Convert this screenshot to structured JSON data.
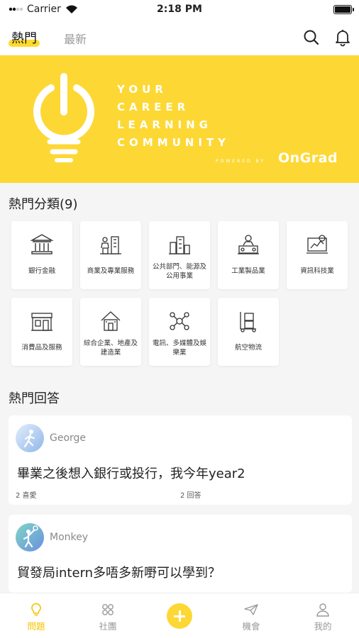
{
  "status_bar": {
    "carrier": "Carrier",
    "time": "2:18 PM"
  },
  "top_nav": {
    "tab_hot": "熱門",
    "tab_latest": "最新"
  },
  "banner": {
    "lines": [
      "YOUR",
      "CAREER",
      "LEARNING",
      "COMMUNITY"
    ],
    "powered_by": "POWERED BY",
    "logo": "OnGrad"
  },
  "categories_section": {
    "title": "熱門分類(9)",
    "items": [
      {
        "label": "銀行金融",
        "icon": "bank-icon"
      },
      {
        "label": "商業及專業服務",
        "icon": "business-icon"
      },
      {
        "label": "公共部門、能源及公用事業",
        "icon": "public-sector-icon"
      },
      {
        "label": "工業製品業",
        "icon": "industrial-icon"
      },
      {
        "label": "資訊科技業",
        "icon": "it-icon"
      },
      {
        "label": "消費品及服務",
        "icon": "consumer-icon"
      },
      {
        "label": "綜合企業、地產及建造業",
        "icon": "property-icon"
      },
      {
        "label": "電訊、多媒體及娛樂業",
        "icon": "telecom-icon"
      },
      {
        "label": "航空物流",
        "icon": "logistics-icon"
      }
    ]
  },
  "answers_section": {
    "title": "熱門回答",
    "cards": [
      {
        "user": "George",
        "question": "畢業之後想入銀行或投行，我今年year2",
        "likes": "2 喜愛",
        "answers": "2 回答"
      },
      {
        "user": "Monkey",
        "question": "貿發局intern多唔多新嘢可以學到？",
        "likes": "",
        "answers": ""
      }
    ]
  },
  "tab_bar": {
    "items": [
      {
        "label": "問題",
        "icon": "lightbulb-icon",
        "active": true
      },
      {
        "label": "社團",
        "icon": "community-icon",
        "active": false
      },
      {
        "label": "",
        "icon": "add-icon",
        "active": false
      },
      {
        "label": "機會",
        "icon": "paper-plane-icon",
        "active": false
      },
      {
        "label": "我的",
        "icon": "profile-icon",
        "active": false
      }
    ]
  },
  "colors": {
    "accent": "#fdd835",
    "active_tab": "#f4c400",
    "background": "#f5f5f5"
  }
}
